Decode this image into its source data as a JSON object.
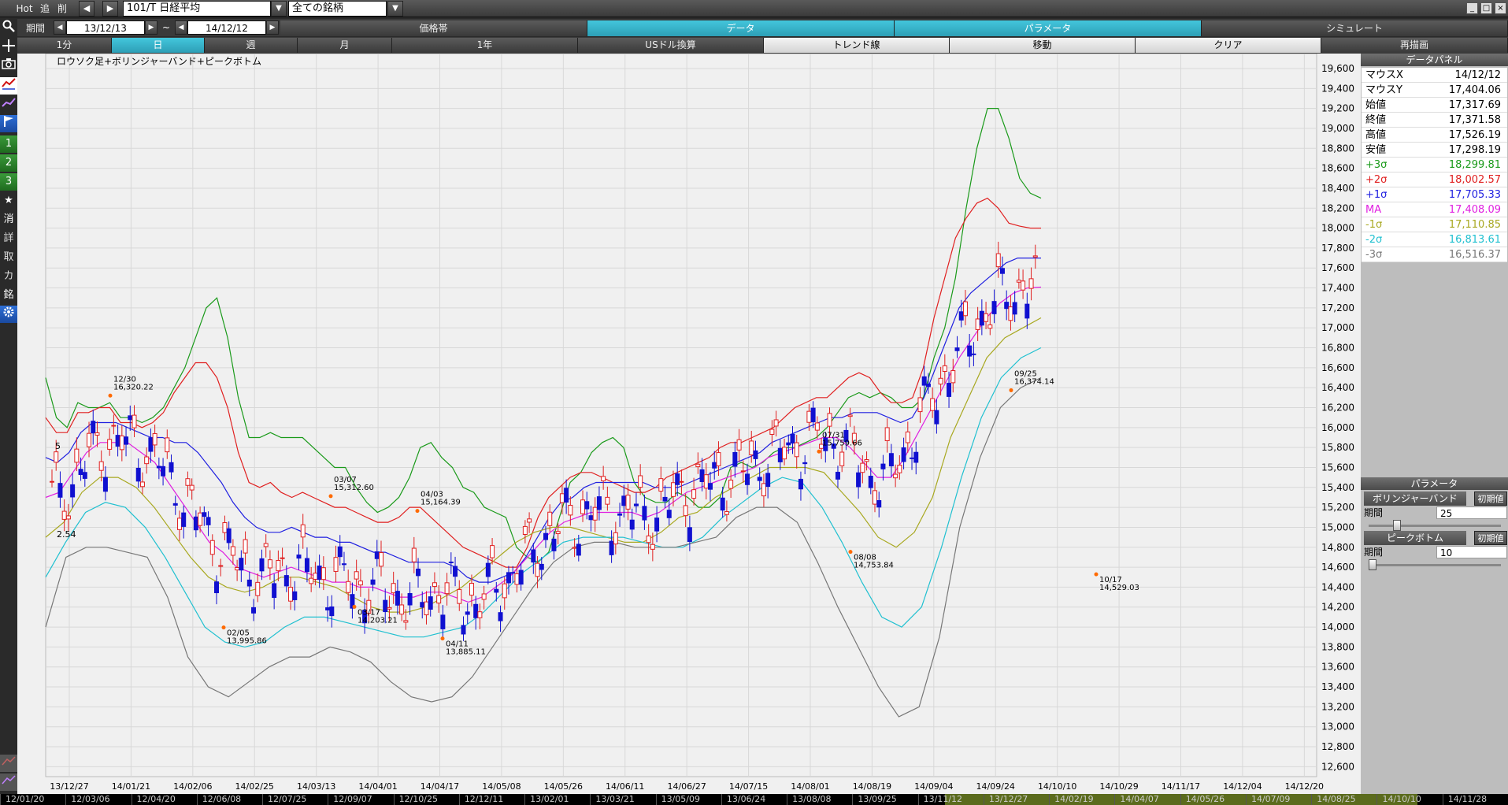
{
  "topbar": {
    "hot": "Hot",
    "add": "追",
    "del": "削",
    "symbol": "101/T 日経平均",
    "filter": "全ての銘柄",
    "window_buttons": [
      "_",
      "□",
      "×"
    ]
  },
  "period_bar": {
    "label": "期間",
    "start": "13/12/13",
    "sep": "~",
    "end": "14/12/12",
    "tabs": [
      "価格帯",
      "データ",
      "パラメータ",
      "シミュレート"
    ],
    "active_tabs": [
      "データ",
      "パラメータ"
    ]
  },
  "interval_bar": {
    "tabs": [
      "1分",
      "日",
      "週",
      "月",
      "1年",
      "USドル換算",
      "トレンド線",
      "移動",
      "クリア",
      "再描画"
    ],
    "active": "日"
  },
  "left_tools": [
    "search-icon",
    "crosshair-icon",
    "camera-icon",
    "line-chart-icon",
    "trend-icon",
    "flag-icon",
    "1",
    "2",
    "3",
    "★",
    "消",
    "詳",
    "取",
    "カ",
    "銘",
    "gear-icon"
  ],
  "chart": {
    "title": "ロウソク足+ボリンジャーバンド+ピークボトム",
    "edge_labels": {
      "left_top": "5",
      "left_mid": "2.54"
    }
  },
  "chart_data": {
    "type": "candlestick",
    "title": "ロウソク足+ボリンジャーバンド+ピークボトム",
    "yaxis_ticks": [
      19600,
      19400,
      19200,
      19000,
      18800,
      18600,
      18400,
      18200,
      18000,
      17800,
      17600,
      17400,
      17200,
      17000,
      16800,
      16600,
      16400,
      16200,
      16000,
      15800,
      15600,
      15400,
      15200,
      15000,
      14800,
      14600,
      14400,
      14200,
      14000,
      13800,
      13600,
      13400,
      13200,
      13000,
      12800,
      12600
    ],
    "ylim": [
      12500,
      19750
    ],
    "xaxis_ticks": [
      "13/12/27",
      "14/01/21",
      "14/02/06",
      "14/02/25",
      "14/03/13",
      "14/04/01",
      "14/04/17",
      "14/05/08",
      "14/05/26",
      "14/06/11",
      "14/06/27",
      "14/07/15",
      "14/08/01",
      "14/08/19",
      "14/09/04",
      "14/09/24",
      "14/10/10",
      "14/10/29",
      "14/11/17",
      "14/12/04",
      "14/12/20"
    ],
    "annotations": [
      {
        "date": "12/30",
        "value": "16,320.22"
      },
      {
        "date": "02/05",
        "value": "13,995.86"
      },
      {
        "date": "03/07",
        "value": "15,312.60"
      },
      {
        "date": "03/17",
        "value": "14,203.21"
      },
      {
        "date": "04/03",
        "value": "15,164.39"
      },
      {
        "date": "04/11",
        "value": "13,885.11"
      },
      {
        "date": "07/31",
        "value": "15,759.66"
      },
      {
        "date": "08/08",
        "value": "14,753.84"
      },
      {
        "date": "09/25",
        "value": "16,374.14"
      },
      {
        "date": "10/17",
        "value": "14,529.03"
      }
    ],
    "series": [
      {
        "name": "+3σ",
        "color": "#1a9a1a",
        "values": [
          16500,
          16100,
          16000,
          16250,
          16200,
          16200,
          16250,
          16100,
          16100,
          16050,
          16100,
          16200,
          16400,
          16600,
          16900,
          17200,
          17300,
          16900,
          16300,
          15900,
          15900,
          15950,
          15900,
          15900,
          15900,
          15800,
          15700,
          15600,
          15600,
          15400,
          15250,
          15150,
          15200,
          15300,
          15500,
          15800,
          15850,
          15700,
          15600,
          15400,
          15350,
          15200,
          15150,
          15100,
          14800,
          14700,
          14650,
          14750,
          15100,
          15450,
          15550,
          15750,
          15850,
          15900,
          15800,
          15450,
          15300,
          15250,
          15250,
          15350,
          15300,
          15200,
          15200,
          15300,
          15600,
          15650,
          15600,
          15650,
          15750,
          15800,
          15800,
          15850,
          15900,
          16000,
          16150,
          16300,
          16350,
          16300,
          16350,
          16300,
          16200,
          16200,
          16300,
          16700,
          17000,
          17500,
          18200,
          18800,
          19200,
          19200,
          18900,
          18500,
          18350,
          18300
        ]
      },
      {
        "name": "+2σ",
        "color": "#e02020",
        "values": [
          16100,
          15950,
          15950,
          16150,
          16150,
          16200,
          16200,
          16050,
          16050,
          16000,
          16050,
          16150,
          16350,
          16500,
          16650,
          16650,
          16500,
          16200,
          15750,
          15450,
          15400,
          15450,
          15350,
          15300,
          15350,
          15300,
          15250,
          15200,
          15200,
          15150,
          15100,
          15050,
          15050,
          15100,
          15200,
          15200,
          15100,
          15000,
          14900,
          14800,
          14750,
          14700,
          14650,
          14600,
          14600,
          14800,
          15100,
          15300,
          15400,
          15500,
          15550,
          15550,
          15500,
          15450,
          15400,
          15350,
          15350,
          15400,
          15500,
          15550,
          15600,
          15650,
          15700,
          15800,
          15850,
          15850,
          15900,
          15950,
          16000,
          16100,
          16200,
          16250,
          16300,
          16300,
          16400,
          16500,
          16550,
          16500,
          16350,
          16250,
          16250,
          16300,
          16600,
          17100,
          17500,
          17900,
          18100,
          18250,
          18300,
          18200,
          18050,
          18020,
          18000,
          18000
        ]
      },
      {
        "name": "+1σ",
        "color": "#2020e0",
        "values": [
          15700,
          15650,
          15750,
          15950,
          16050,
          16050,
          16050,
          16000,
          15950,
          15900,
          15900,
          15850,
          15850,
          15750,
          15600,
          15450,
          15250,
          15100,
          15000,
          14950,
          14950,
          15000,
          14950,
          14900,
          14900,
          14850,
          14850,
          14800,
          14750,
          14750,
          14700,
          14650,
          14650,
          14650,
          14650,
          14600,
          14500,
          14450,
          14450,
          14500,
          14550,
          14700,
          14900,
          15100,
          15250,
          15300,
          15400,
          15450,
          15450,
          15450,
          15450,
          15450,
          15400,
          15400,
          15400,
          15450,
          15500,
          15550,
          15600,
          15650,
          15700,
          15750,
          15850,
          15900,
          15950,
          16000,
          16050,
          16100,
          16100,
          16150,
          16150,
          16150,
          16100,
          16050,
          16100,
          16300,
          16600,
          16900,
          17200,
          17350,
          17450,
          17550,
          17650,
          17700,
          17700,
          17700
        ]
      },
      {
        "name": "MA",
        "color": "#e020e0",
        "values": [
          15300,
          15350,
          15550,
          15750,
          15850,
          15850,
          15850,
          15750,
          15650,
          15450,
          15250,
          15050,
          14850,
          14750,
          14600,
          14550,
          14500,
          14550,
          14600,
          14550,
          14500,
          14450,
          14450,
          14400,
          14400,
          14350,
          14300,
          14300,
          14350,
          14350,
          14300,
          14250,
          14300,
          14400,
          14500,
          14650,
          14800,
          14950,
          15050,
          15100,
          15150,
          15150,
          15150,
          15150,
          15100,
          15150,
          15250,
          15350,
          15400,
          15450,
          15500,
          15550,
          15600,
          15700,
          15750,
          15800,
          15850,
          15900,
          15900,
          15800,
          15650,
          15500,
          15500,
          15700,
          15950,
          16200,
          16450,
          16700,
          16900,
          17100,
          17250,
          17350,
          17400,
          17408
        ]
      },
      {
        "name": "-1σ",
        "color": "#a8a820",
        "values": [
          14900,
          15050,
          15350,
          15500,
          15500,
          15400,
          15200,
          14950,
          14700,
          14500,
          14400,
          14350,
          14400,
          14500,
          14500,
          14450,
          14400,
          14300,
          14200,
          14150,
          14150,
          14200,
          14300,
          14400,
          14550,
          14700,
          14850,
          14950,
          15000,
          15000,
          14950,
          14900,
          14850,
          14850,
          14950,
          15100,
          15150,
          15300,
          15400,
          15500,
          15600,
          15600,
          15600,
          15550,
          15350,
          15150,
          14900,
          14800,
          14950,
          15300,
          15900,
          16300,
          16700,
          16900,
          17000,
          17100
        ]
      },
      {
        "name": "-2σ",
        "color": "#20c0d0",
        "values": [
          14500,
          14850,
          15150,
          15250,
          15200,
          15000,
          14700,
          14350,
          14000,
          13850,
          13800,
          13850,
          14000,
          14100,
          14100,
          14050,
          14000,
          13950,
          13900,
          13900,
          13950,
          14000,
          14150,
          14350,
          14550,
          14700,
          14850,
          14900,
          14900,
          14900,
          14850,
          14800,
          14800,
          14900,
          15100,
          15250,
          15400,
          15500,
          15450,
          15200,
          14850,
          14450,
          14100,
          14000,
          14200,
          14800,
          15500,
          16100,
          16500,
          16700,
          16800
        ]
      },
      {
        "name": "-3σ",
        "color": "#777777",
        "values": [
          14000,
          14700,
          14800,
          14800,
          14750,
          14700,
          14300,
          13700,
          13400,
          13300,
          13450,
          13600,
          13700,
          13700,
          13800,
          13750,
          13650,
          13450,
          13300,
          13250,
          13300,
          13500,
          13800,
          14100,
          14400,
          14650,
          14800,
          14850,
          14850,
          14800,
          14800,
          14800,
          14850,
          14900,
          15100,
          15200,
          15200,
          15050,
          14650,
          14200,
          13800,
          13400,
          13100,
          13200,
          13900,
          15000,
          15700,
          16200,
          16400,
          16500
        ]
      }
    ]
  },
  "data_panel": {
    "title": "データパネル",
    "rows": [
      {
        "k": "マウスX",
        "v": "14/12/12",
        "color": "#000000"
      },
      {
        "k": "マウスY",
        "v": "17,404.06",
        "color": "#000000"
      },
      {
        "k": "始値",
        "v": "17,317.69",
        "color": "#000000"
      },
      {
        "k": "終値",
        "v": "17,371.58",
        "color": "#000000"
      },
      {
        "k": "高値",
        "v": "17,526.19",
        "color": "#000000"
      },
      {
        "k": "安値",
        "v": "17,298.19",
        "color": "#000000"
      },
      {
        "k": "+3σ",
        "v": "18,299.81",
        "color": "#1a9a1a"
      },
      {
        "k": "+2σ",
        "v": "18,002.57",
        "color": "#e02020"
      },
      {
        "k": "+1σ",
        "v": "17,705.33",
        "color": "#2020e0"
      },
      {
        "k": "MA",
        "v": "17,408.09",
        "color": "#e020e0"
      },
      {
        "k": "-1σ",
        "v": "17,110.85",
        "color": "#a8a820"
      },
      {
        "k": "-2σ",
        "v": "16,813.61",
        "color": "#20c0d0"
      },
      {
        "k": "-3σ",
        "v": "16,516.37",
        "color": "#777777"
      }
    ]
  },
  "param_panel": {
    "title": "パラメータ",
    "bollinger": {
      "label": "ボリンジャーバンド",
      "reset": "初期値",
      "field": "期間",
      "value": "25"
    },
    "peak": {
      "label": "ピークボトム",
      "reset": "初期値",
      "field": "期間",
      "value": "10"
    }
  },
  "bottom_nav": [
    "12/01/20",
    "12/03/06",
    "12/04/20",
    "12/06/08",
    "12/07/25",
    "12/09/07",
    "12/10/25",
    "12/12/11",
    "13/02/01",
    "13/03/21",
    "13/05/09",
    "13/06/24",
    "13/08/08",
    "13/09/25",
    "13/11/12",
    "13/12/27",
    "14/02/19",
    "14/04/07",
    "14/05/26",
    "14/07/09",
    "14/08/25",
    "14/10/10",
    "14/11/28"
  ]
}
